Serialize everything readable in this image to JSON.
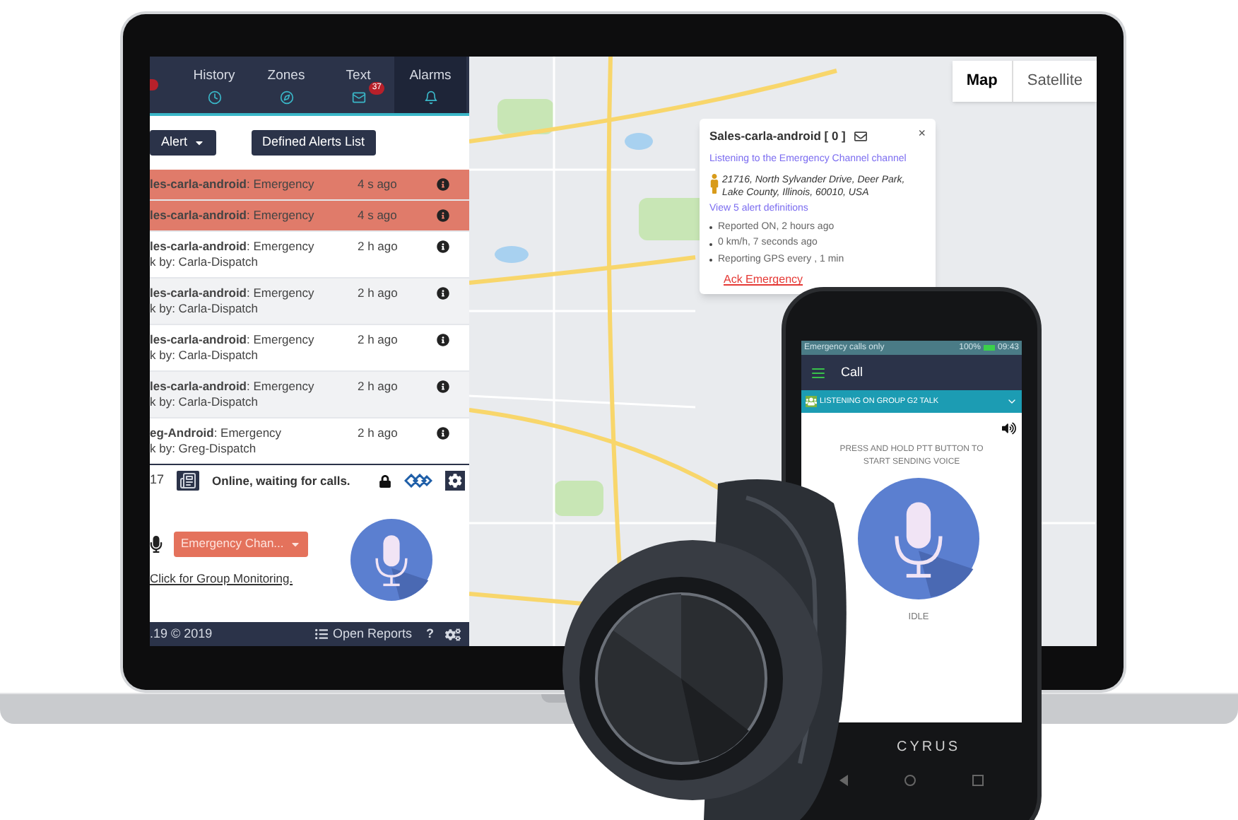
{
  "dispatch": {
    "tabs": [
      {
        "label": "History",
        "selected": false
      },
      {
        "label": "Zones",
        "selected": false
      },
      {
        "label": "Text",
        "badge": "37",
        "selected": false
      },
      {
        "label": "Alarms",
        "selected": true
      }
    ],
    "buttons": [
      {
        "label": "Alert",
        "kind": "dropdown"
      },
      {
        "label": "Defined Alerts List",
        "kind": "plain"
      }
    ],
    "alerts": [
      {
        "text": "**les-carla-android**: Emergency",
        "time": "4 s ago",
        "highlighted": true
      },
      {
        "text": "**les-carla-android**: Emergency",
        "time": "4 s ago",
        "highlighted": true
      },
      {
        "text": "**les-carla-android**: Emergency",
        "ack": "k by: Carla-Dispatch",
        "time": "2 h ago",
        "highlighted": false
      },
      {
        "text": "**les-carla-android**: Emergency",
        "ack": "k by: Carla-Dispatch",
        "time": "2 h ago",
        "highlighted": false
      },
      {
        "text": "**les-carla-android**: Emergency",
        "ack": "k by: Carla-Dispatch",
        "time": "2 h ago",
        "highlighted": false
      },
      {
        "text": "**les-carla-android**: Emergency",
        "ack": "k by: Carla-Dispatch",
        "time": "2 h ago",
        "highlighted": false
      },
      {
        "text": "**eg-Android**: Emergency",
        "ack": "k by: Greg-Dispatch",
        "time": "2 h ago",
        "highlighted": false
      }
    ],
    "status": {
      "count": "17",
      "message": "Online, waiting for calls."
    },
    "channel": "Emergency Chan...",
    "monitor_link": "Click for Group Monitoring.",
    "footer": {
      "version": ".19 © 2019",
      "reports": "Open Reports",
      "help": "?"
    }
  },
  "map": {
    "types": [
      {
        "label": "Map",
        "selected": true
      },
      {
        "label": "Satellite",
        "selected": false
      }
    ],
    "popup": {
      "title": "Sales-carla-android [ 0 ]",
      "close": "×",
      "channel": "Listening to the Emergency Channel channel",
      "address": "21716, North Sylvander Drive, Deer Park, Lake County, Illinois, 60010, USA",
      "definitions": "View 5 alert definitions",
      "facts": [
        "Reported ON, 2 hours ago",
        "0 km/h, 7 seconds ago",
        "Reporting GPS every , 1 min"
      ],
      "ack": "Ack Emergency"
    }
  },
  "phone": {
    "status": {
      "carrier": "Emergency calls only",
      "battery": "100%",
      "time": "09:43"
    },
    "title": "Call",
    "group": "LISTENING ON GROUP G2 TALK",
    "hint": "PRESS AND HOLD PTT BUTTON TO START SENDING VOICE",
    "state": "IDLE",
    "brand": "CYRUS"
  }
}
